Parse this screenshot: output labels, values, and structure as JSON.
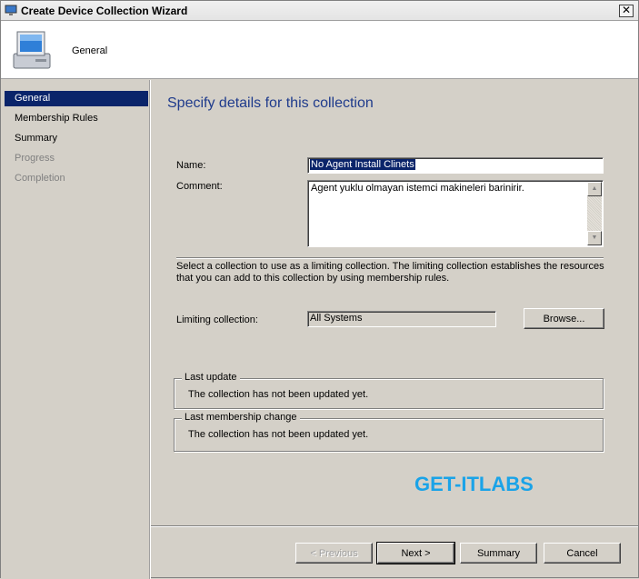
{
  "window": {
    "title": "Create Device Collection Wizard",
    "close_label": "✕"
  },
  "header": {
    "title": "General"
  },
  "sidebar": {
    "items": [
      {
        "label": "General",
        "state": "active"
      },
      {
        "label": "Membership Rules",
        "state": "normal"
      },
      {
        "label": "Summary",
        "state": "normal"
      },
      {
        "label": "Progress",
        "state": "disabled"
      },
      {
        "label": "Completion",
        "state": "disabled"
      }
    ]
  },
  "main": {
    "heading": "Specify details for this collection",
    "name_label": "Name:",
    "name_value": "No Agent Install Clinets",
    "comment_label": "Comment:",
    "comment_value": "Agent yuklu olmayan istemci makineleri barinirir.",
    "limiting_help": "Select a collection to use as a limiting collection. The limiting collection establishes the resources that you can add to this collection by using membership rules.",
    "limiting_label": "Limiting collection:",
    "limiting_value": "All Systems",
    "browse_label": "Browse...",
    "last_update_title": "Last update",
    "last_update_text": "The collection has not been updated yet.",
    "last_change_title": "Last membership change",
    "last_change_text": "The collection has not been updated yet."
  },
  "watermark": "GET-ITLABS",
  "footer": {
    "previous_label": "< Previous",
    "next_label": "Next >",
    "summary_label": "Summary",
    "cancel_label": "Cancel"
  },
  "colors": {
    "accent": "#0a246a",
    "heading": "#1f3b8c",
    "watermark": "#1aa3e8"
  }
}
